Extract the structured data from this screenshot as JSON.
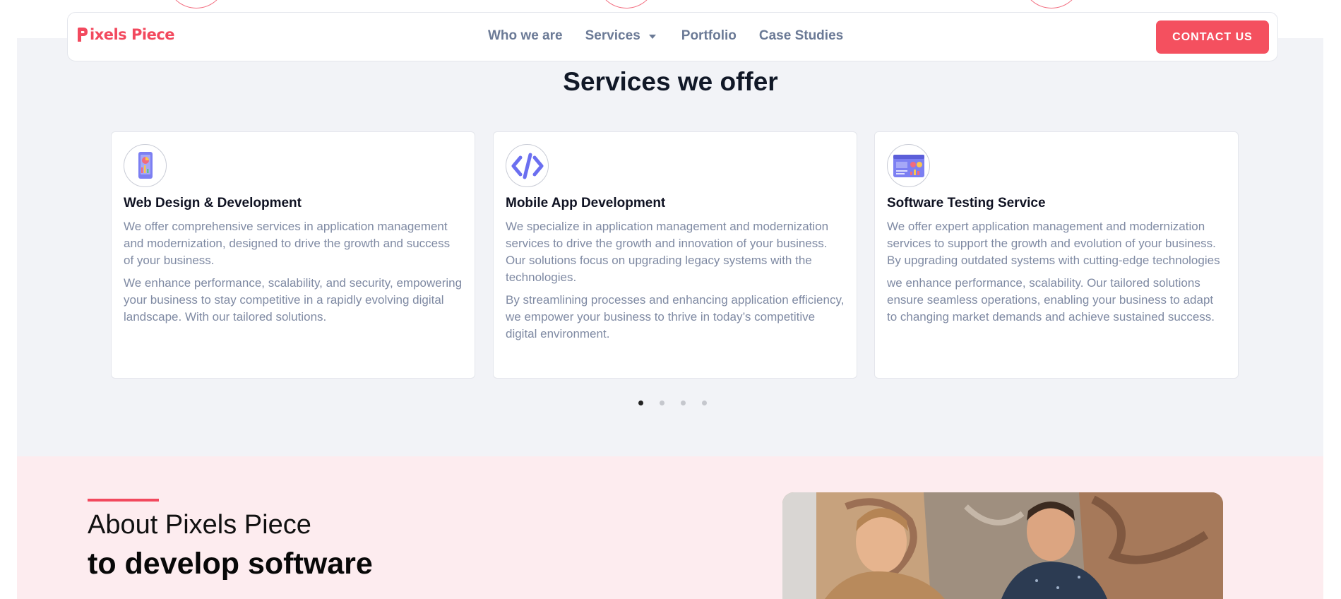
{
  "navbar": {
    "logo_text": "ixels Piece",
    "links": [
      {
        "label": "Who we are"
      },
      {
        "label": "Services"
      },
      {
        "label": "Portfolio"
      },
      {
        "label": "Case Studies"
      }
    ],
    "contact_label": "CONTACT US"
  },
  "services": {
    "title": "Services we offer",
    "cards": [
      {
        "icon": "mobile-analytics-icon",
        "title": "Web Design & Development",
        "p1": "We offer comprehensive services in application management and modernization, designed to drive the growth and success of your business.",
        "p2": "We enhance performance, scalability, and security, empowering your business to stay competitive in a rapidly evolving digital landscape. With our tailored solutions."
      },
      {
        "icon": "code-icon",
        "title": "Mobile App Development",
        "p1": "We specialize in application management and modernization services to drive the growth and innovation of your business. Our solutions focus on upgrading legacy systems with the technologies.",
        "p2": "By streamlining processes and enhancing application efficiency, we empower your business to thrive in today’s competitive digital environment."
      },
      {
        "icon": "dashboard-chart-icon",
        "title": "Software Testing Service",
        "p1": "We offer expert application management and modernization services to support the growth and evolution of your business. By upgrading outdated systems with cutting-edge technologies",
        "p2": "we enhance performance, scalability. Our tailored solutions ensure seamless operations, enabling your business to adapt to changing market demands and achieve sustained success."
      }
    ],
    "pagination": {
      "pages": 4,
      "active": 1
    }
  },
  "about": {
    "title": "About Pixels Piece",
    "subtitle": "to develop software"
  },
  "colors": {
    "brand": "#f2495e",
    "nav_text": "#6b7a96",
    "body_text": "#7f8aa3",
    "section_bg": "#f2f3f7",
    "about_bg": "#fdecef"
  }
}
